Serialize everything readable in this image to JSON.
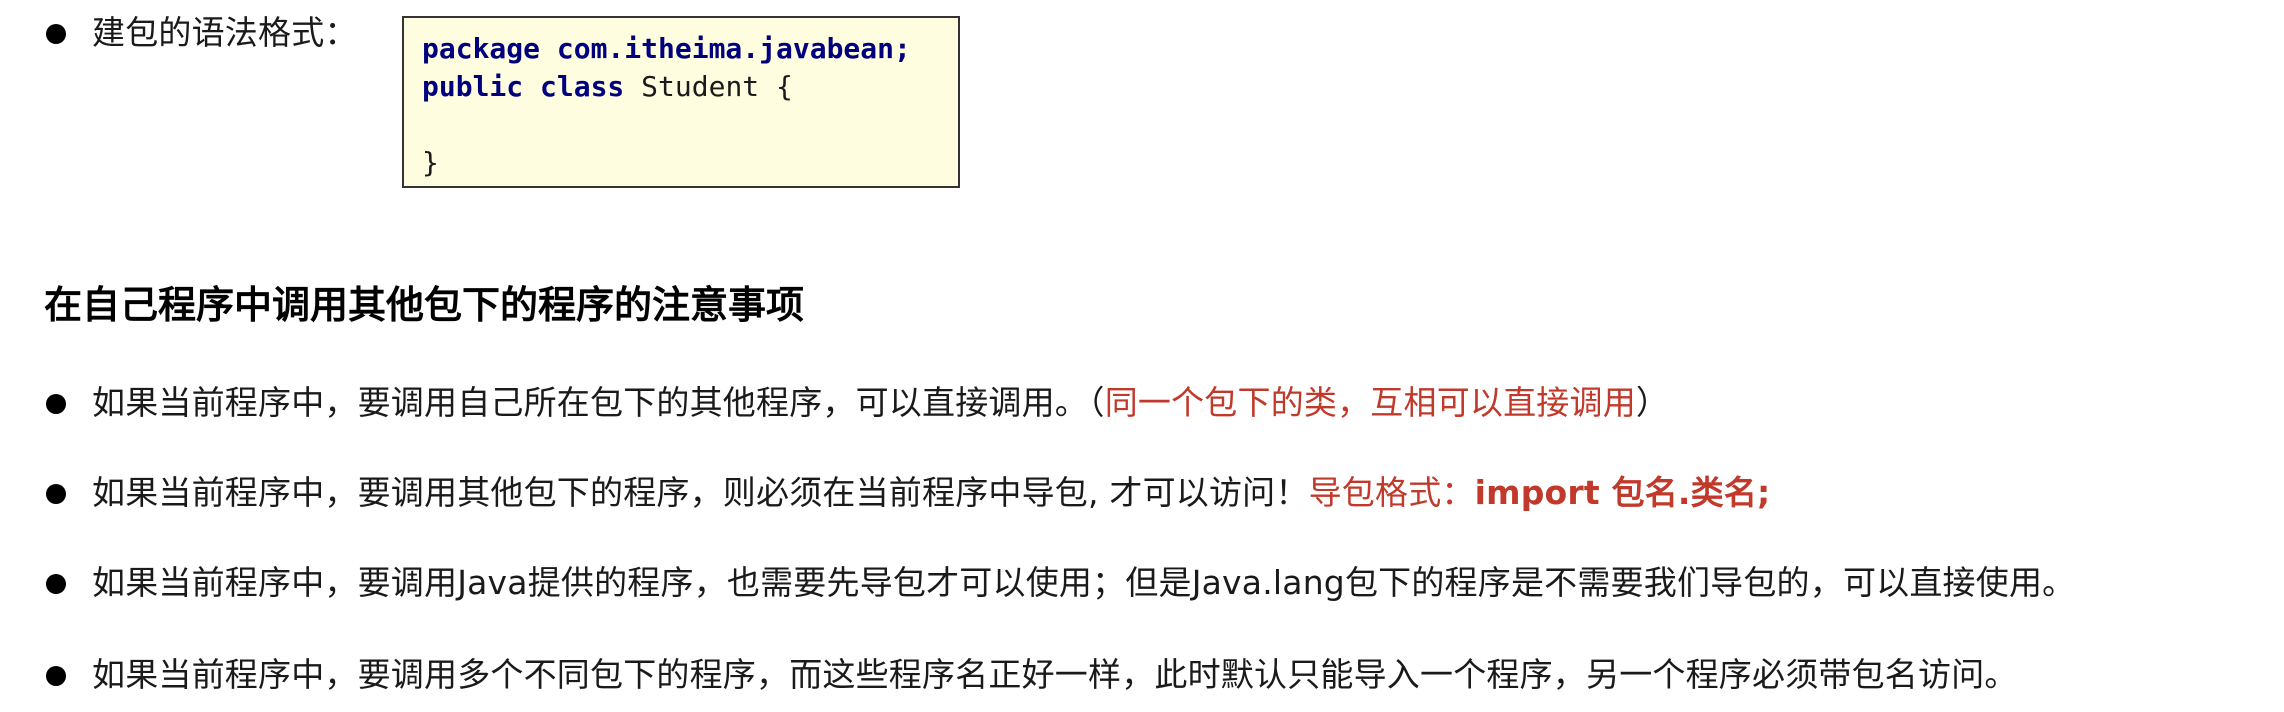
{
  "intro": {
    "label": "建包的语法格式："
  },
  "code": {
    "line1_kw": "package com.itheima.javabean;",
    "line2_kw": "public class",
    "line2_rest": " Student {",
    "line3": "",
    "line4": "}"
  },
  "heading": "在自己程序中调用其他包下的程序的注意事项",
  "bullets": [
    {
      "text": "如果当前程序中，要调用自己所在包下的其他程序，可以直接调用。（",
      "highlight": "同一个包下的类，互相可以直接调用",
      "suffix": "）"
    },
    {
      "text": "如果当前程序中，要调用其他包下的程序，则必须在当前程序中导包, 才可以访问！",
      "highlight": "导包格式：",
      "highlight_bold": "import 包名.类名;"
    },
    {
      "text": "如果当前程序中，要调用Java提供的程序，也需要先导包才可以使用；但是Java.lang包下的程序是不需要我们导包的，可以直接使用。"
    },
    {
      "text": "如果当前程序中，要调用多个不同包下的程序，而这些程序名正好一样，此时默认只能导入一个程序，另一个程序必须带包名访问。"
    }
  ],
  "colors": {
    "highlight": "#c0392b",
    "code_bg": "#fffde0",
    "code_keyword": "#00007f"
  }
}
